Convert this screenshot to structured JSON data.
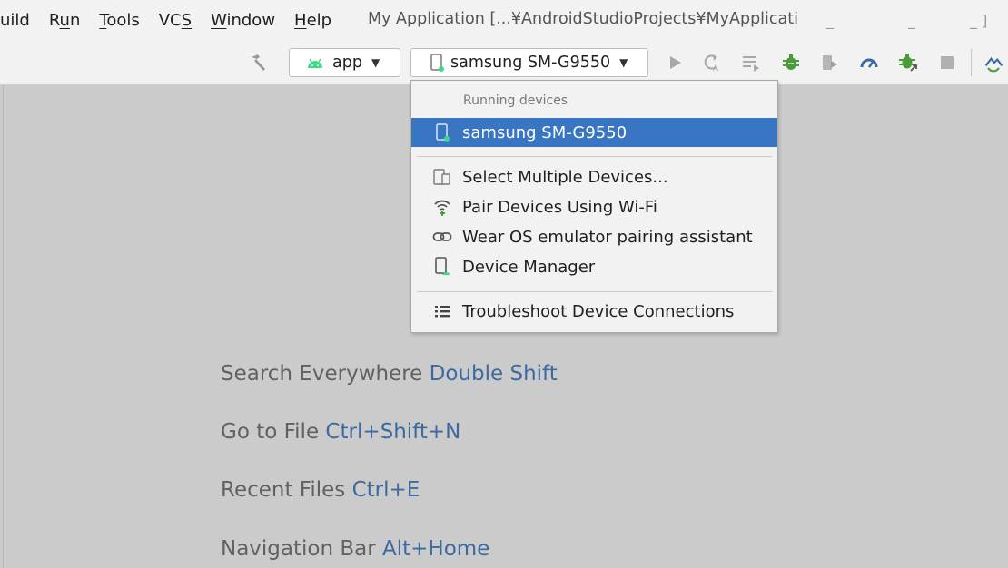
{
  "menu": {
    "build": "uild",
    "run": "Run",
    "tools": "Tools",
    "vcs": "VCS",
    "window": "Window",
    "help": "Help"
  },
  "window_title": "My Application [...¥AndroidStudioProjects¥MyApplicati",
  "toolbar": {
    "config_label": "app",
    "device_label": "samsung SM-G9550",
    "icons": [
      "hammer-icon",
      "android-icon",
      "phone-icon",
      "run-icon",
      "apply-changes-icon",
      "apply-code-changes-icon",
      "debug-icon",
      "attach-icon",
      "profile-icon",
      "attach-debugger-icon",
      "stop-icon",
      "sync-icon"
    ]
  },
  "dropdown": {
    "header": "Running devices",
    "selected_device": "samsung SM-G9550",
    "items": [
      {
        "label": "Select Multiple Devices...",
        "icon": "multi-device-icon"
      },
      {
        "label": "Pair Devices Using Wi-Fi",
        "icon": "wifi-icon"
      },
      {
        "label": "Wear OS emulator pairing assistant",
        "icon": "link-icon"
      },
      {
        "label": "Device Manager",
        "icon": "device-manager-icon"
      },
      {
        "label": "Troubleshoot Device Connections",
        "icon": "list-icon"
      }
    ]
  },
  "hints": [
    {
      "text": "Search Everywhere",
      "key": "Double Shift"
    },
    {
      "text": "Go to File",
      "key": "Ctrl+Shift+N"
    },
    {
      "text": "Recent Files",
      "key": "Ctrl+E"
    },
    {
      "text": "Navigation Bar",
      "key": "Alt+Home"
    }
  ],
  "colors": {
    "selection": "#3875c2",
    "shortcut": "#3c6aa0",
    "android_green": "#3ddc84",
    "debug_green": "#4a9b3a"
  }
}
